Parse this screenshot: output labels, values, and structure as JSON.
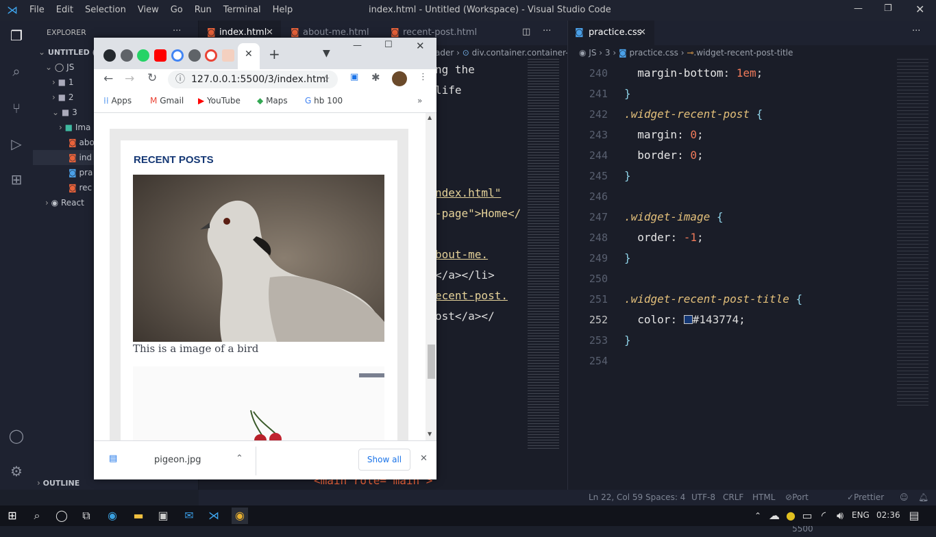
{
  "titlebar": {
    "menu": [
      "File",
      "Edit",
      "Selection",
      "View",
      "Go",
      "Run",
      "Terminal",
      "Help"
    ],
    "title": "index.html - Untitled (Workspace) - Visual Studio Code"
  },
  "sidebar": {
    "header": "EXPLORER",
    "workspace": "UNTITLED (W",
    "items": [
      {
        "label": "JS",
        "indent": 1
      },
      {
        "label": "1",
        "indent": 2
      },
      {
        "label": "2",
        "indent": 2
      },
      {
        "label": "3",
        "indent": 2
      },
      {
        "label": "Ima",
        "indent": 3
      },
      {
        "label": "abo",
        "indent": 3
      },
      {
        "label": "ind",
        "indent": 3
      },
      {
        "label": "pra",
        "indent": 3
      },
      {
        "label": "rec",
        "indent": 3
      },
      {
        "label": "React",
        "indent": 1
      }
    ],
    "outline": "OUTLINE"
  },
  "editor1": {
    "tabs": [
      "index.html",
      "about-me.html",
      "recent-post.html"
    ],
    "breadcrumb_tail": "ader",
    "breadcrumb_item": "div.container.container-",
    "fragments": [
      "ng the",
      "life",
      "ndex.html\"",
      "-page\">Home</",
      "bout-me.",
      "</a></li>",
      "ecent-post.",
      "ost</a></",
      "<main role= main >"
    ]
  },
  "editor2": {
    "tab": "practice.css",
    "breadcrumb": [
      "JS",
      "3",
      "practice.css",
      ".widget-recent-post-title"
    ],
    "lines": [
      {
        "n": "240",
        "text": "  margin-bottom: 1em;"
      },
      {
        "n": "241",
        "text": "}"
      },
      {
        "n": "242",
        "text": ".widget-recent-post {"
      },
      {
        "n": "243",
        "text": "  margin: 0;"
      },
      {
        "n": "244",
        "text": "  border: 0;"
      },
      {
        "n": "245",
        "text": "}"
      },
      {
        "n": "246",
        "text": ""
      },
      {
        "n": "247",
        "text": ".widget-image {"
      },
      {
        "n": "248",
        "text": "  order: -1;"
      },
      {
        "n": "249",
        "text": "}"
      },
      {
        "n": "250",
        "text": ""
      },
      {
        "n": "251",
        "text": ".widget-recent-post-title {"
      },
      {
        "n": "252",
        "text": "  color: #143774;"
      },
      {
        "n": "253",
        "text": "}"
      },
      {
        "n": "254",
        "text": ""
      }
    ],
    "swatch_color": "#143774"
  },
  "statusbar": {
    "position": "Ln 22, Col 59",
    "spaces": "Spaces: 4",
    "encoding": "UTF-8",
    "eol": "CRLF",
    "lang": "HTML",
    "port": "Port : 5500",
    "prettier": "Prettier"
  },
  "chrome": {
    "url": "127.0.0.1:5500/3/index.html",
    "bookmarks": [
      "Apps",
      "Gmail",
      "YouTube",
      "Maps",
      "hb 100"
    ],
    "page": {
      "heading": "RECENT POSTS",
      "caption": "This is a image of a bird"
    },
    "download": {
      "file": "pigeon.jpg",
      "show_all": "Show all"
    }
  },
  "taskbar": {
    "lang": "ENG",
    "time": "02:36"
  }
}
